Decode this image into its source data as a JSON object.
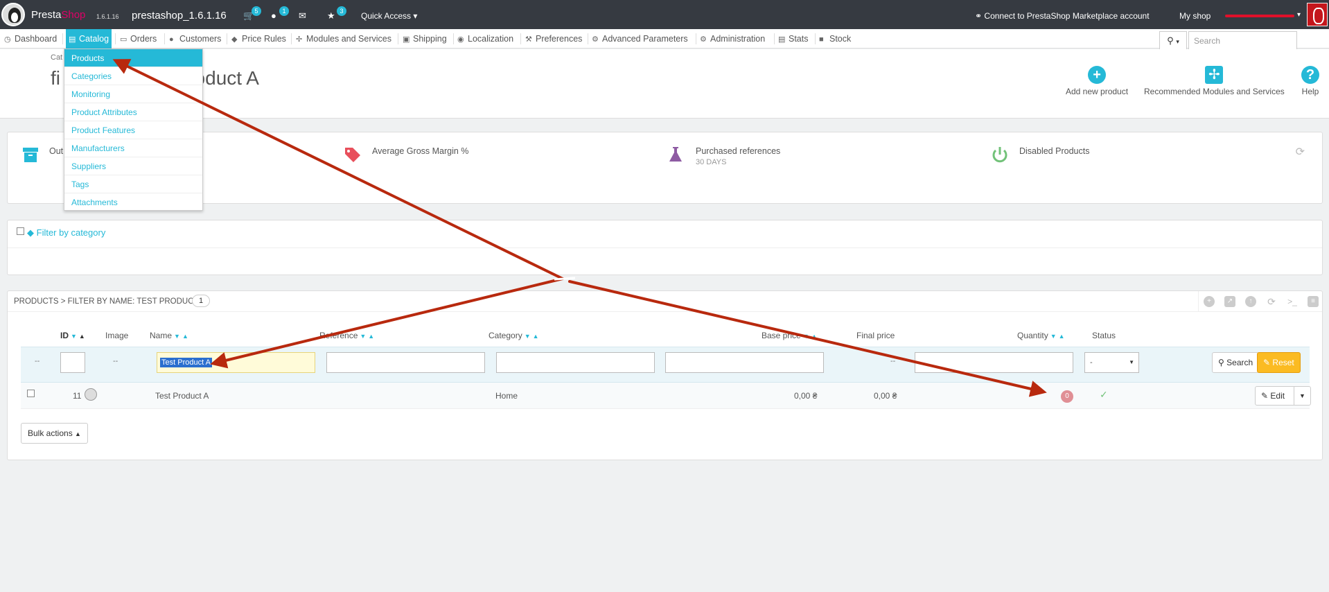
{
  "topbar": {
    "brand_part1": "Presta",
    "brand_part2": "Shop",
    "version": "1.6.1.16",
    "shop_name": "prestashop_1.6.1.16",
    "badges": {
      "orders": "5",
      "customers": "1",
      "messages": "",
      "achievements": "3"
    },
    "quick_access": "Quick Access",
    "connect": "Connect to PrestaShop Marketplace account",
    "my_shop": "My shop"
  },
  "nav": {
    "items": [
      {
        "label": "Dashboard",
        "icon": "dashboard-icon"
      },
      {
        "label": "Catalog",
        "icon": "book-icon"
      },
      {
        "label": "Orders",
        "icon": "credit-card-icon"
      },
      {
        "label": "Customers",
        "icon": "users-icon"
      },
      {
        "label": "Price Rules",
        "icon": "tag-icon"
      },
      {
        "label": "Modules and Services",
        "icon": "puzzle-icon"
      },
      {
        "label": "Shipping",
        "icon": "truck-icon"
      },
      {
        "label": "Localization",
        "icon": "globe-icon"
      },
      {
        "label": "Preferences",
        "icon": "wrench-icon"
      },
      {
        "label": "Advanced Parameters",
        "icon": "cogs-icon"
      },
      {
        "label": "Administration",
        "icon": "cog-icon"
      },
      {
        "label": "Stats",
        "icon": "bar-chart-icon"
      },
      {
        "label": "Stock",
        "icon": "stock-icon"
      }
    ],
    "search_placeholder": "Search"
  },
  "catalog_menu": [
    "Products",
    "Categories",
    "Monitoring",
    "Product Attributes",
    "Product Features",
    "Manufacturers",
    "Suppliers",
    "Tags",
    "Attachments"
  ],
  "header": {
    "breadcrumb": "Cat",
    "title": "filter by name: Test Product A",
    "title_visible_start": "fi",
    "title_visible_end": "st Product A",
    "actions": {
      "add": "Add new product",
      "recommended": "Recommended Modules and Services",
      "help": "Help"
    }
  },
  "kpi": {
    "out_of_stock": "Out",
    "gross_margin": "Average Gross Margin %",
    "purchased": "Purchased references",
    "purchased_sub": "30 DAYS",
    "disabled": "Disabled Products"
  },
  "category_filter": {
    "label": "Filter by category"
  },
  "products": {
    "heading": "Products > Filter by name: Test Product A",
    "count": "1",
    "columns": {
      "id": "ID",
      "image": "Image",
      "name": "Name",
      "reference": "Reference",
      "category": "Category",
      "base_price": "Base price",
      "final_price": "Final price",
      "quantity": "Quantity",
      "status": "Status"
    },
    "filters": {
      "dash": "--",
      "name_value": "Test Product A",
      "final_price_dash": "--",
      "status_value": "-",
      "search": "Search",
      "reset": "Reset"
    },
    "row": {
      "id": "11",
      "name": "Test Product A",
      "category": "Home",
      "base_price": "0,00 ₴",
      "final_price": "0,00 ₴",
      "quantity": "0",
      "edit": "Edit"
    },
    "bulk": "Bulk actions"
  },
  "colors": {
    "accent": "#25b9d7",
    "topbar": "#363a41",
    "arrow": "#b8290e",
    "reset": "#fbbb22"
  }
}
